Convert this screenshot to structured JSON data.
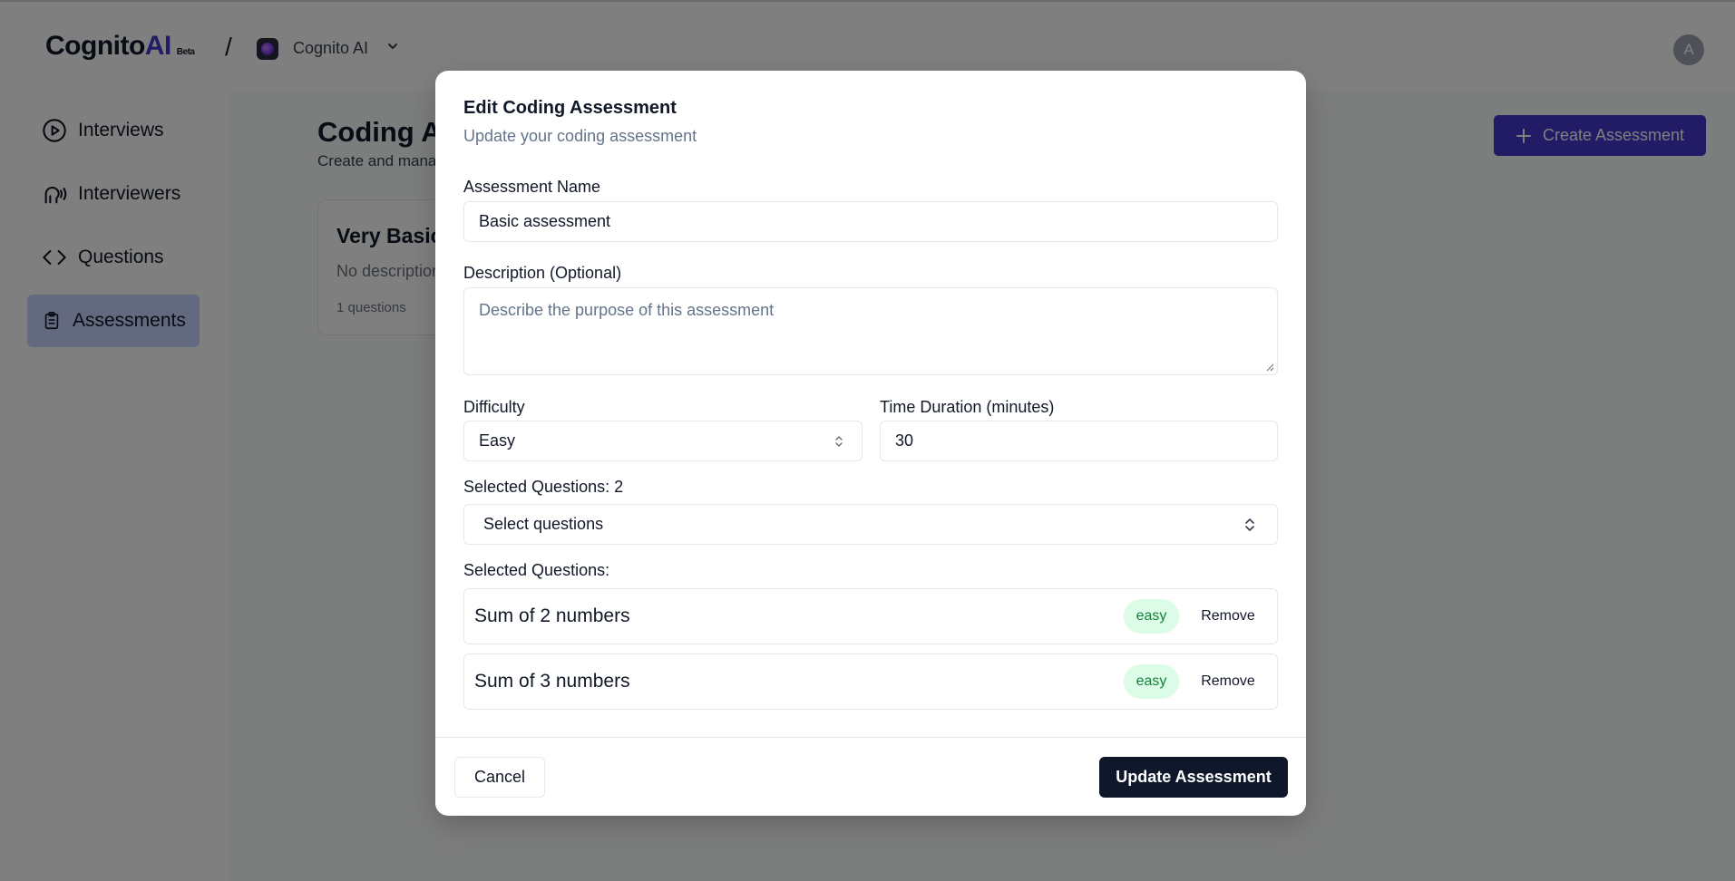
{
  "header": {
    "logo_main": "Cognito",
    "logo_accent": "AI",
    "logo_badge": "Beta",
    "separator": "/",
    "org_name": "Cognito AI",
    "avatar_initial": "A"
  },
  "sidebar": {
    "items": [
      {
        "label": "Interviews",
        "icon": "play-circle-icon"
      },
      {
        "label": "Interviewers",
        "icon": "speaking-head-icon"
      },
      {
        "label": "Questions",
        "icon": "code-icon"
      },
      {
        "label": "Assessments",
        "icon": "clipboard-icon",
        "active": true
      }
    ]
  },
  "main": {
    "title": "Coding Assessments",
    "subtitle": "Create and manage coding assessments",
    "create_button": "Create Assessment",
    "card": {
      "title": "Very Basic",
      "description": "No description",
      "count": "1 questions"
    }
  },
  "modal": {
    "title": "Edit Coding Assessment",
    "subtitle": "Update your coding assessment",
    "name_label": "Assessment Name",
    "name_value": "Basic assessment",
    "description_label": "Description (Optional)",
    "description_placeholder": "Describe the purpose of this assessment",
    "difficulty_label": "Difficulty",
    "difficulty_value": "Easy",
    "duration_label": "Time Duration (minutes)",
    "duration_value": "30",
    "selected_count_label": "Selected Questions: 2",
    "select_placeholder": "Select questions",
    "selected_list_label": "Selected Questions:",
    "questions": [
      {
        "name": "Sum of 2 numbers",
        "difficulty": "easy",
        "action": "Remove"
      },
      {
        "name": "Sum of 3 numbers",
        "difficulty": "easy",
        "action": "Remove"
      }
    ],
    "cancel_button": "Cancel",
    "update_button": "Update Assessment"
  },
  "colors": {
    "brand": "#4338ca",
    "primary_dark": "#0f172a",
    "badge_easy_bg": "#dcfce7",
    "badge_easy_text": "#15803d",
    "active_nav_bg": "#c7d2fe"
  }
}
